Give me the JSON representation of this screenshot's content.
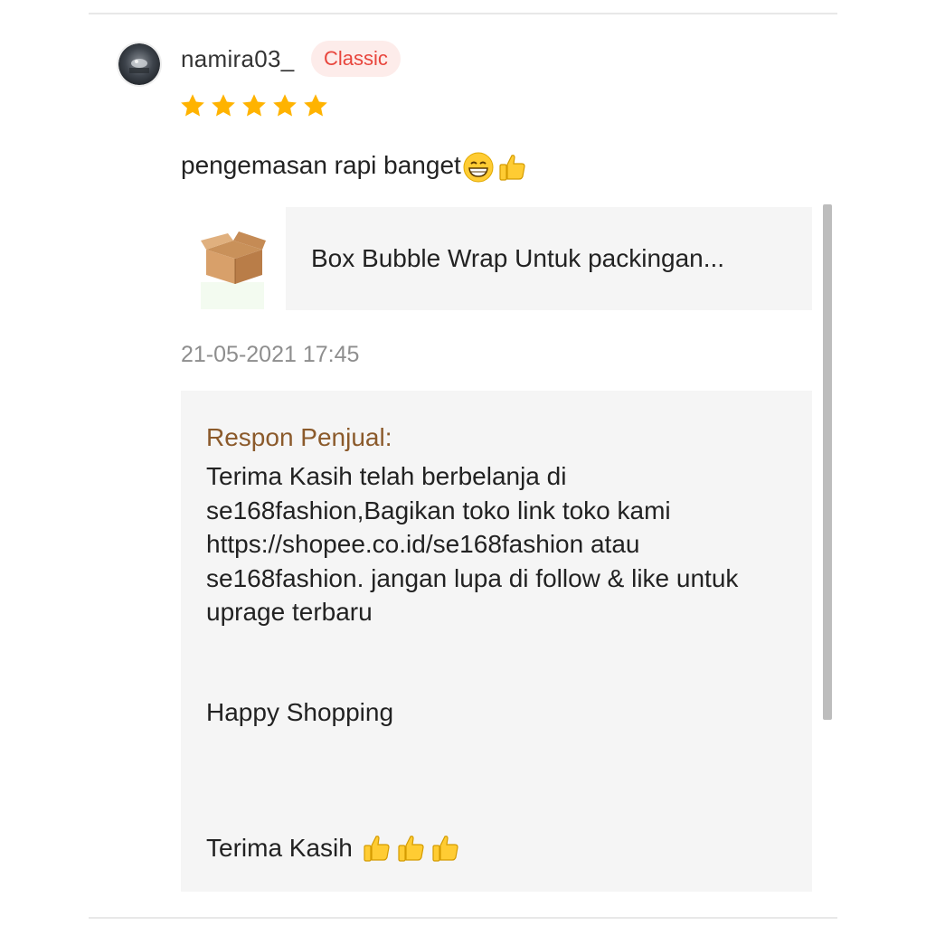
{
  "review": {
    "username": "namira03_",
    "badge": "Classic",
    "rating": 5,
    "comment": "pengemasan rapi banget",
    "comment_emojis": [
      "grinning-face-icon",
      "thumbs-up-icon"
    ],
    "timestamp": "21-05-2021 17:45"
  },
  "product": {
    "name": "Box Bubble Wrap Untuk packingan...",
    "thumbnail_icon": "cardboard-box-icon"
  },
  "seller_response": {
    "title": "Respon Penjual:",
    "body": "Terima Kasih telah berbelanja di se168fashion,Bagikan toko link toko kami https://shopee.co.id/se168fashion atau se168fashion. jangan lupa di follow & like untuk uprage terbaru",
    "happy": "Happy Shopping",
    "thanks": "Terima Kasih",
    "thanks_emojis": [
      "thumbs-up-icon",
      "thumbs-up-icon",
      "thumbs-up-icon"
    ]
  },
  "colors": {
    "badge_text": "#e8453c",
    "badge_bg": "#fdecea",
    "star": "#ffb300",
    "seller_title": "#8b5a2b",
    "card_bg": "#f5f5f5"
  }
}
